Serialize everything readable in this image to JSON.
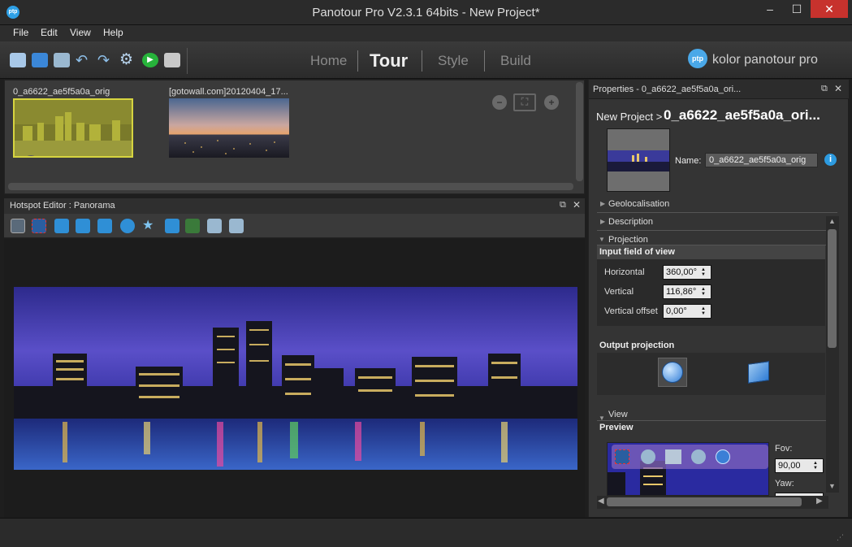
{
  "window": {
    "title": "Panotour Pro V2.3.1 64bits - New Project*",
    "app_logo": "ptp",
    "controls": {
      "minimize": "–",
      "maximize": "☐",
      "close": "✕"
    }
  },
  "menu": [
    "File",
    "Edit",
    "View",
    "Help"
  ],
  "toolbar": {
    "icons": [
      "open-project-icon",
      "save-icon",
      "add-panorama-icon",
      "undo-icon",
      "redo-icon",
      "settings-gear-icon",
      "run-icon",
      "folder-icon"
    ],
    "nav_tabs": [
      {
        "label": "Home",
        "active": false
      },
      {
        "label": "Tour",
        "active": true
      },
      {
        "label": "Style",
        "active": false
      },
      {
        "label": "Build",
        "active": false
      }
    ],
    "brand": {
      "logo": "ptp",
      "text": "kolor panotour pro"
    }
  },
  "thumbnails": [
    {
      "label": "0_a6622_ae5f5a0a_orig",
      "selected": true
    },
    {
      "label": "[gotowall.com]20120404_17...",
      "selected": false
    }
  ],
  "thumb_zoom": {
    "minus": "−",
    "fit": "⛶",
    "plus": "+"
  },
  "hotspot_editor": {
    "title": "Hotspot Editor : Panorama",
    "tools": [
      "select-arrow-icon",
      "select-rect-icon",
      "add-arrow-hotspot-icon",
      "add-image-hotspot-icon",
      "add-video-hotspot-icon",
      "add-circle-hotspot-icon",
      "add-star-hotspot-icon",
      "add-point-hotspot-icon",
      "add-polygon-hotspot-icon",
      "add-landscape-hotspot-icon",
      "add-panorama-hotspot-icon"
    ]
  },
  "properties": {
    "title": "Properties - 0_a6622_ae5f5a0a_ori...",
    "breadcrumb_prefix": "New Project >",
    "breadcrumb_name": "0_a6622_ae5f5a0a_ori...",
    "name_label": "Name:",
    "name_value": "0_a6622_ae5f5a0a_orig",
    "info": "i",
    "sections": {
      "geolocalisation": "Geolocalisation",
      "description": "Description",
      "projection": "Projection",
      "view": "View"
    },
    "input_fov": {
      "header": "Input field of view",
      "horizontal_label": "Horizontal",
      "horizontal_value": "360,00°",
      "vertical_label": "Vertical",
      "vertical_value": "116,86°",
      "vertical_offset_label": "Vertical offset",
      "vertical_offset_value": "0,00°"
    },
    "output_projection": {
      "header": "Output projection",
      "options": [
        "spherical-projection-icon",
        "flat-projection-icon"
      ]
    },
    "preview": {
      "header": "Preview",
      "fov_label": "Fov:",
      "fov_value": "90,00",
      "yaw_label": "Yaw:"
    }
  },
  "colors": {
    "accent": "#2d9be0",
    "selection": "#d6d440",
    "close_button": "#c7322d"
  }
}
